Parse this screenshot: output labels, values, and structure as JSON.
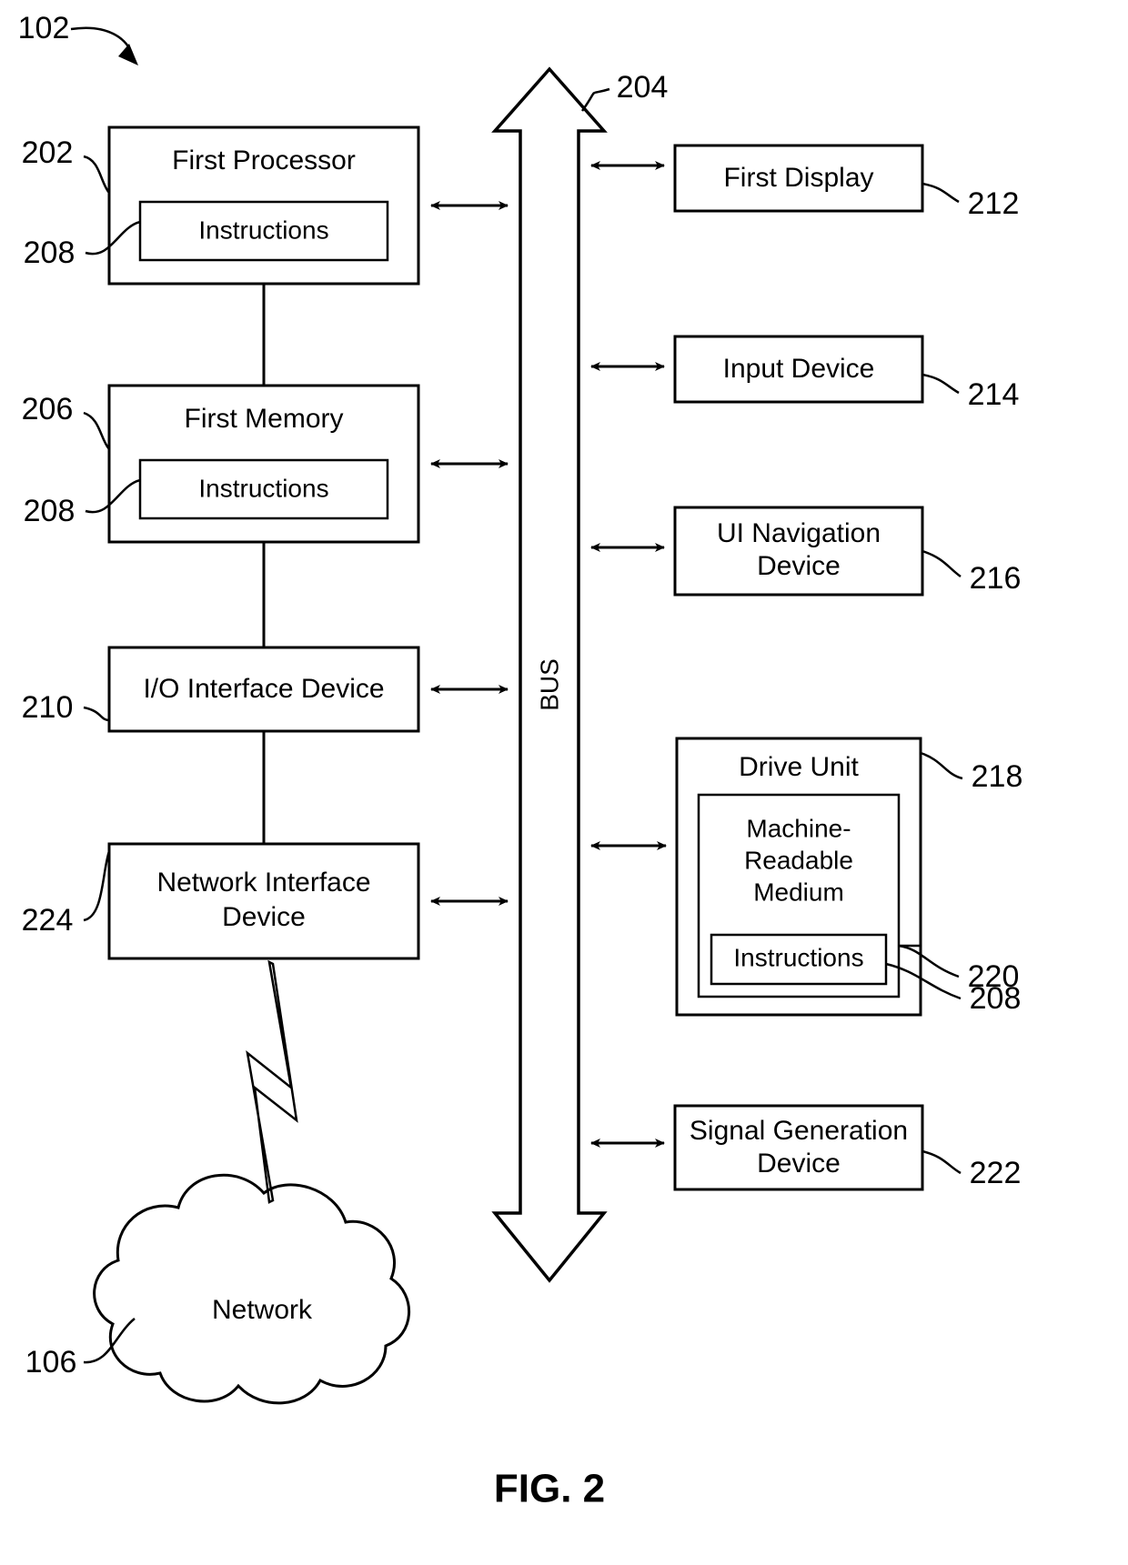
{
  "figure": {
    "caption": "FIG. 2",
    "system_ref": "102"
  },
  "bus": {
    "label": "BUS",
    "ref": "204"
  },
  "left_column": [
    {
      "id": "first-processor",
      "label": "First Processor",
      "ref": "202",
      "inner": {
        "label": "Instructions",
        "ref": "208"
      }
    },
    {
      "id": "first-memory",
      "label": "First Memory",
      "ref": "206",
      "inner": {
        "label": "Instructions",
        "ref": "208"
      }
    },
    {
      "id": "io-interface-device",
      "label": "I/O Interface Device",
      "ref": "210",
      "inner": null
    },
    {
      "id": "network-interface-device",
      "label_line1": "Network Interface",
      "label_line2": "Device",
      "ref": "224",
      "inner": null
    }
  ],
  "right_column": [
    {
      "id": "first-display",
      "label": "First Display",
      "ref": "212"
    },
    {
      "id": "input-device",
      "label": "Input Device",
      "ref": "214"
    },
    {
      "id": "ui-navigation-device",
      "label_line1": "UI Navigation",
      "label_line2": "Device",
      "ref": "216"
    },
    {
      "id": "drive-unit",
      "label": "Drive Unit",
      "ref": "218",
      "medium": {
        "label_line1": "Machine-",
        "label_line2": "Readable",
        "label_line3": "Medium",
        "ref": "220",
        "inner": {
          "label": "Instructions",
          "ref": "208"
        }
      }
    },
    {
      "id": "signal-generation-device",
      "label_line1": "Signal Generation",
      "label_line2": "Device",
      "ref": "222"
    }
  ],
  "network": {
    "label": "Network",
    "ref": "106",
    "link_icon": "lightning-bolt-icon"
  },
  "colors": {
    "stroke": "#000000",
    "background": "#ffffff"
  }
}
